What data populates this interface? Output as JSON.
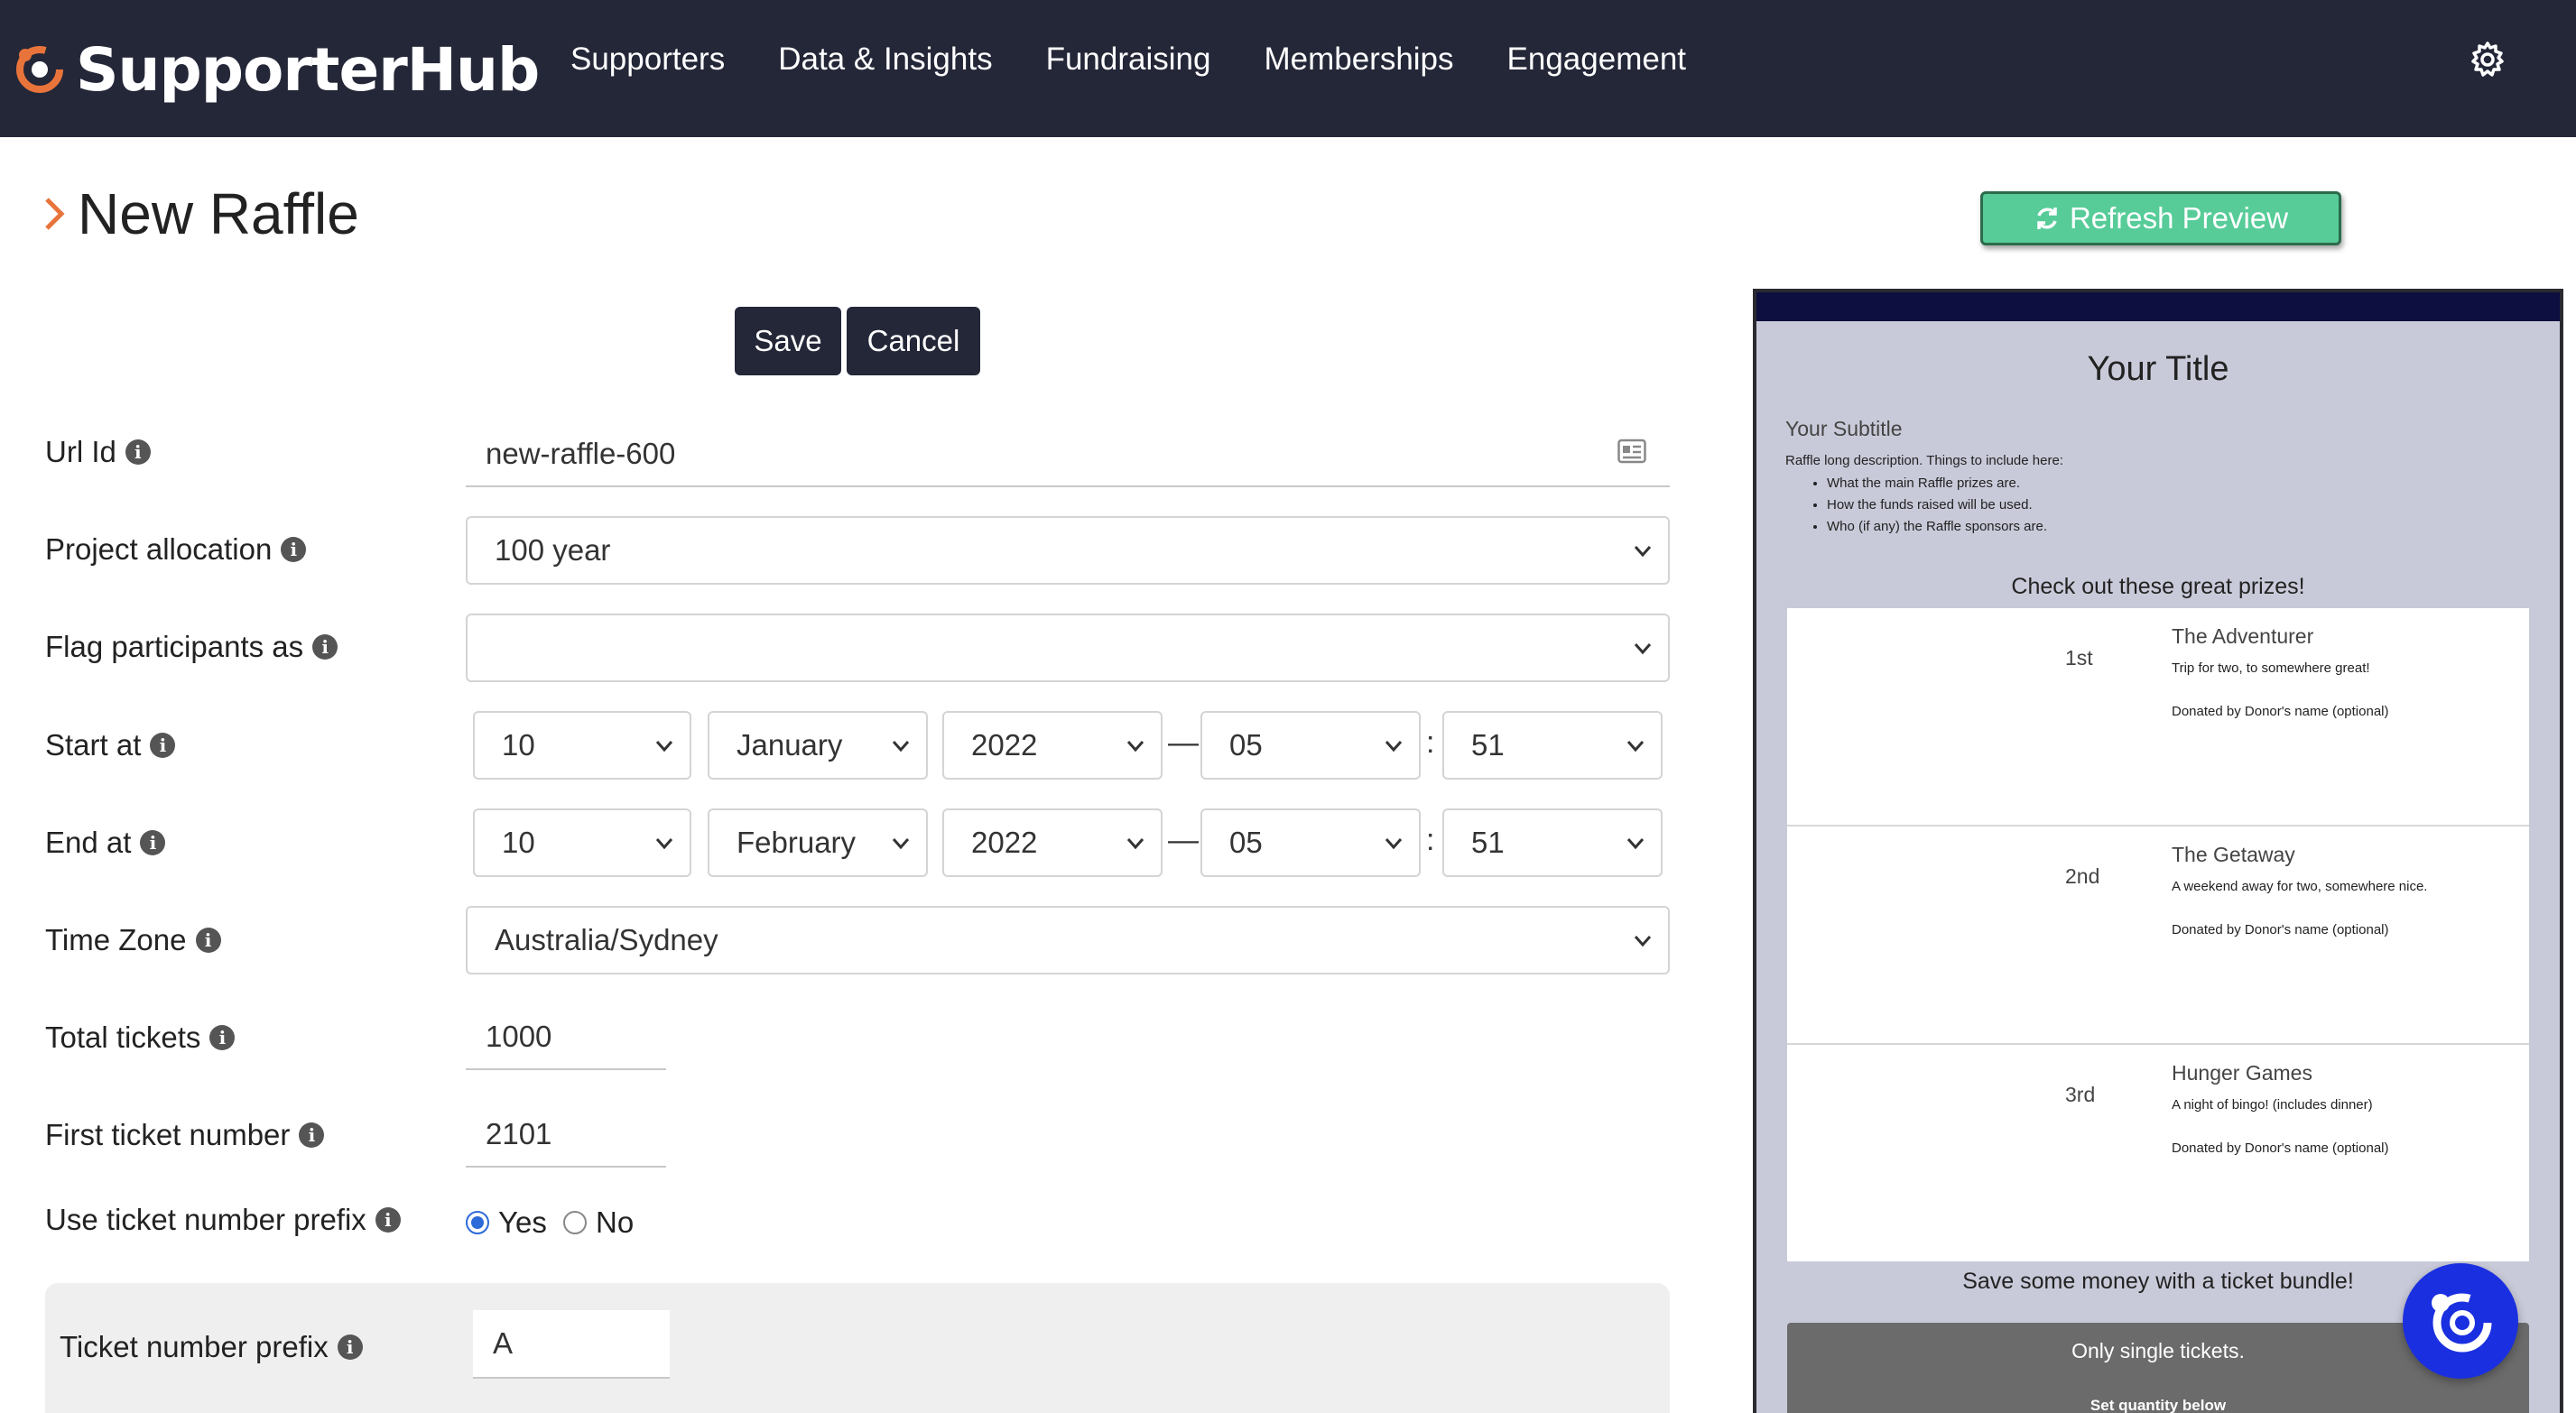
{
  "header": {
    "brand": "SupporterHub",
    "nav": [
      "Supporters",
      "Data & Insights",
      "Fundraising",
      "Memberships",
      "Engagement"
    ]
  },
  "page": {
    "title": "New Raffle",
    "save_label": "Save",
    "cancel_label": "Cancel"
  },
  "form": {
    "url_id": {
      "label": "Url Id",
      "value": "new-raffle-600"
    },
    "project_allocation": {
      "label": "Project allocation",
      "value": "100 year"
    },
    "flag_participants": {
      "label": "Flag participants as",
      "value": ""
    },
    "start_at": {
      "label": "Start at",
      "day": "10",
      "month": "January",
      "year": "2022",
      "hour": "05",
      "minute": "51"
    },
    "end_at": {
      "label": "End at",
      "day": "10",
      "month": "February",
      "year": "2022",
      "hour": "05",
      "minute": "51"
    },
    "time_zone": {
      "label": "Time Zone",
      "value": "Australia/Sydney"
    },
    "total_tickets": {
      "label": "Total tickets",
      "value": "1000"
    },
    "first_ticket_number": {
      "label": "First ticket number",
      "value": "2101"
    },
    "use_prefix": {
      "label": "Use ticket number prefix",
      "yes": "Yes",
      "no": "No",
      "selected": "Yes"
    },
    "ticket_prefix": {
      "label": "Ticket number prefix",
      "value": "A"
    },
    "dash": "—",
    "colon": ":",
    "info_glyph": "i"
  },
  "preview": {
    "refresh_label": "Refresh Preview",
    "title": "Your Title",
    "subtitle": "Your Subtitle",
    "description": "Raffle long description. Things to include here:",
    "bullets": [
      "What the main Raffle prizes are.",
      "How the funds raised will be used.",
      "Who (if any) the Raffle sponsors are."
    ],
    "prizes_heading": "Check out these great prizes!",
    "prizes": [
      {
        "rank": "1st",
        "name": "The Adventurer",
        "desc": "Trip for two, to somewhere great!",
        "donor": "Donated by Donor's name (optional)"
      },
      {
        "rank": "2nd",
        "name": "The Getaway",
        "desc": "A weekend away for two, somewhere nice.",
        "donor": "Donated by Donor's name (optional)"
      },
      {
        "rank": "3rd",
        "name": "Hunger Games",
        "desc": "A night of bingo! (includes dinner)",
        "donor": "Donated by Donor's name (optional)"
      }
    ],
    "bundle_heading": "Save some money with a ticket bundle!",
    "bundle_text": "Only single tickets.",
    "bundle_qty": "Set quantity below"
  },
  "colors": {
    "nav_bg": "#242738",
    "accent_orange": "#e8743b",
    "refresh_green": "#57cc99",
    "chat_blue": "#1a2fe0",
    "radio_blue": "#2d6bd8"
  },
  "icons": {
    "logo": "supporterhub-logo-icon",
    "settings": "gear-icon",
    "title": "chevron-right-icon",
    "info": "info-icon",
    "url_field": "id-card-icon",
    "select": "chevron-down-icon",
    "refresh": "refresh-icon",
    "chat": "chat-icon"
  }
}
